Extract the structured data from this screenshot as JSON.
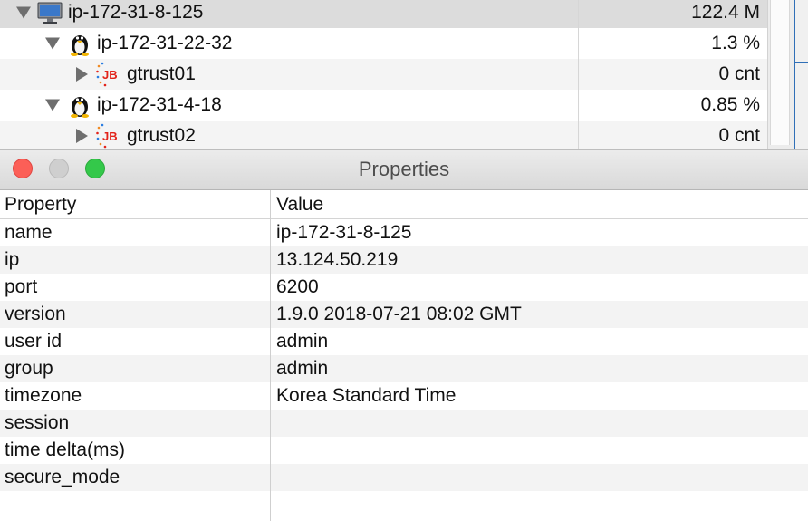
{
  "tree": {
    "rows": [
      {
        "label": "ip-172-31-8-125",
        "value": "122.4 M",
        "icon": "monitor-icon",
        "expanded": true
      },
      {
        "label": "ip-172-31-22-32",
        "value": "1.3 %",
        "icon": "linux-tux-icon",
        "expanded": true
      },
      {
        "label": "gtrust01",
        "value": "0 cnt",
        "icon": "jb-agent-icon",
        "expanded": false
      },
      {
        "label": "ip-172-31-4-18",
        "value": "0.85 %",
        "icon": "linux-tux-icon",
        "expanded": true
      },
      {
        "label": "gtrust02",
        "value": "0 cnt",
        "icon": "jb-agent-icon",
        "expanded": false
      }
    ]
  },
  "window": {
    "title": "Properties"
  },
  "table": {
    "headers": {
      "property": "Property",
      "value": "Value"
    },
    "rows": [
      {
        "property": "name",
        "value": "ip-172-31-8-125"
      },
      {
        "property": "ip",
        "value": "13.124.50.219"
      },
      {
        "property": "port",
        "value": "6200"
      },
      {
        "property": "version",
        "value": "1.9.0 2018-07-21 08:02 GMT"
      },
      {
        "property": "user id",
        "value": "admin"
      },
      {
        "property": "group",
        "value": "admin"
      },
      {
        "property": "timezone",
        "value": "Korea Standard Time"
      },
      {
        "property": "session",
        "value": ""
      },
      {
        "property": "time delta(ms)",
        "value": ""
      },
      {
        "property": "secure_mode",
        "value": ""
      }
    ]
  },
  "colors": {
    "close": "#fc5f57",
    "minimize": "#cfcfcf",
    "zoom": "#34c84a",
    "jb_badge": "#e2231a",
    "selection": "#dcdcdc"
  }
}
